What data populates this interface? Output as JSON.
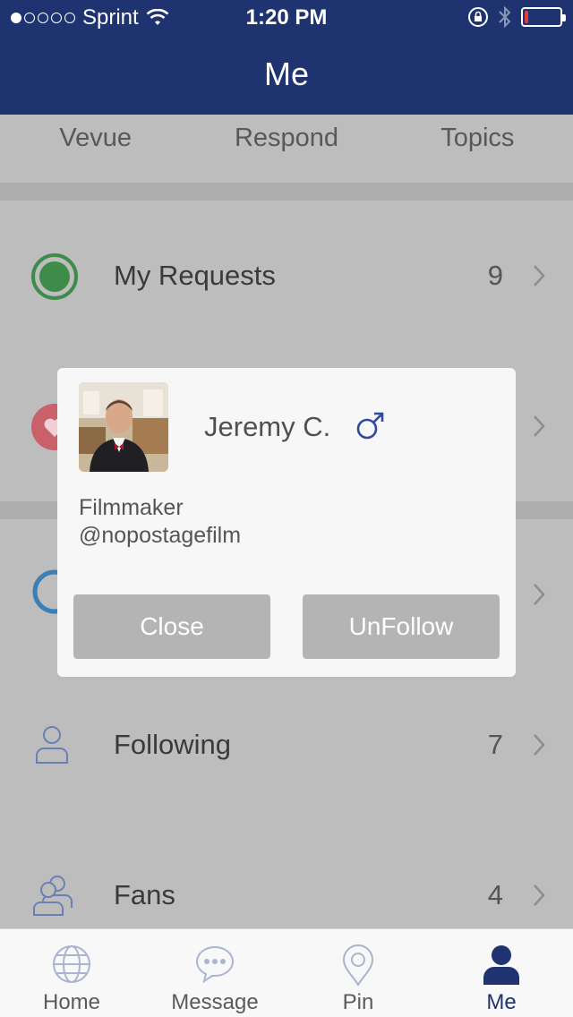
{
  "status_bar": {
    "carrier": "Sprint",
    "time": "1:20 PM",
    "signal_dots_filled": 1,
    "signal_dots_total": 5,
    "battery_level": 0.1,
    "battery_color": "#e33b3b"
  },
  "nav": {
    "title": "Me"
  },
  "tabs": [
    {
      "label": "Vevue"
    },
    {
      "label": "Respond"
    },
    {
      "label": "Topics"
    }
  ],
  "rows": [
    {
      "label": "My Requests",
      "count": "9",
      "icon": "status-circle-icon"
    },
    {
      "label": "",
      "count": "",
      "icon": "heart-icon"
    },
    {
      "label": "",
      "count": "",
      "icon": "ring-icon"
    },
    {
      "label": "Following",
      "count": "7",
      "icon": "person-outline-icon"
    },
    {
      "label": "Fans",
      "count": "4",
      "icon": "people-outline-icon"
    }
  ],
  "modal": {
    "name": "Jeremy C.",
    "gender_symbol": "♂",
    "bio_line1": "Filmmaker",
    "bio_line2": "@nopostagefilm",
    "close_label": "Close",
    "unfollow_label": "UnFollow"
  },
  "tab_bar": [
    {
      "label": "Home",
      "icon": "globe-icon"
    },
    {
      "label": "Message",
      "icon": "chat-bubble-icon"
    },
    {
      "label": "Pin",
      "icon": "location-pin-icon"
    },
    {
      "label": "Me",
      "icon": "person-icon",
      "active": true
    }
  ],
  "colors": {
    "brand": "#1f3370",
    "overlay_bg": "#bdbdbd",
    "button_gray": "#b4b4b4",
    "green": "#3d8c4a",
    "heart_red": "#c9606a",
    "ring_blue": "#3b7fb5",
    "gender_blue": "#2d4aa0"
  }
}
